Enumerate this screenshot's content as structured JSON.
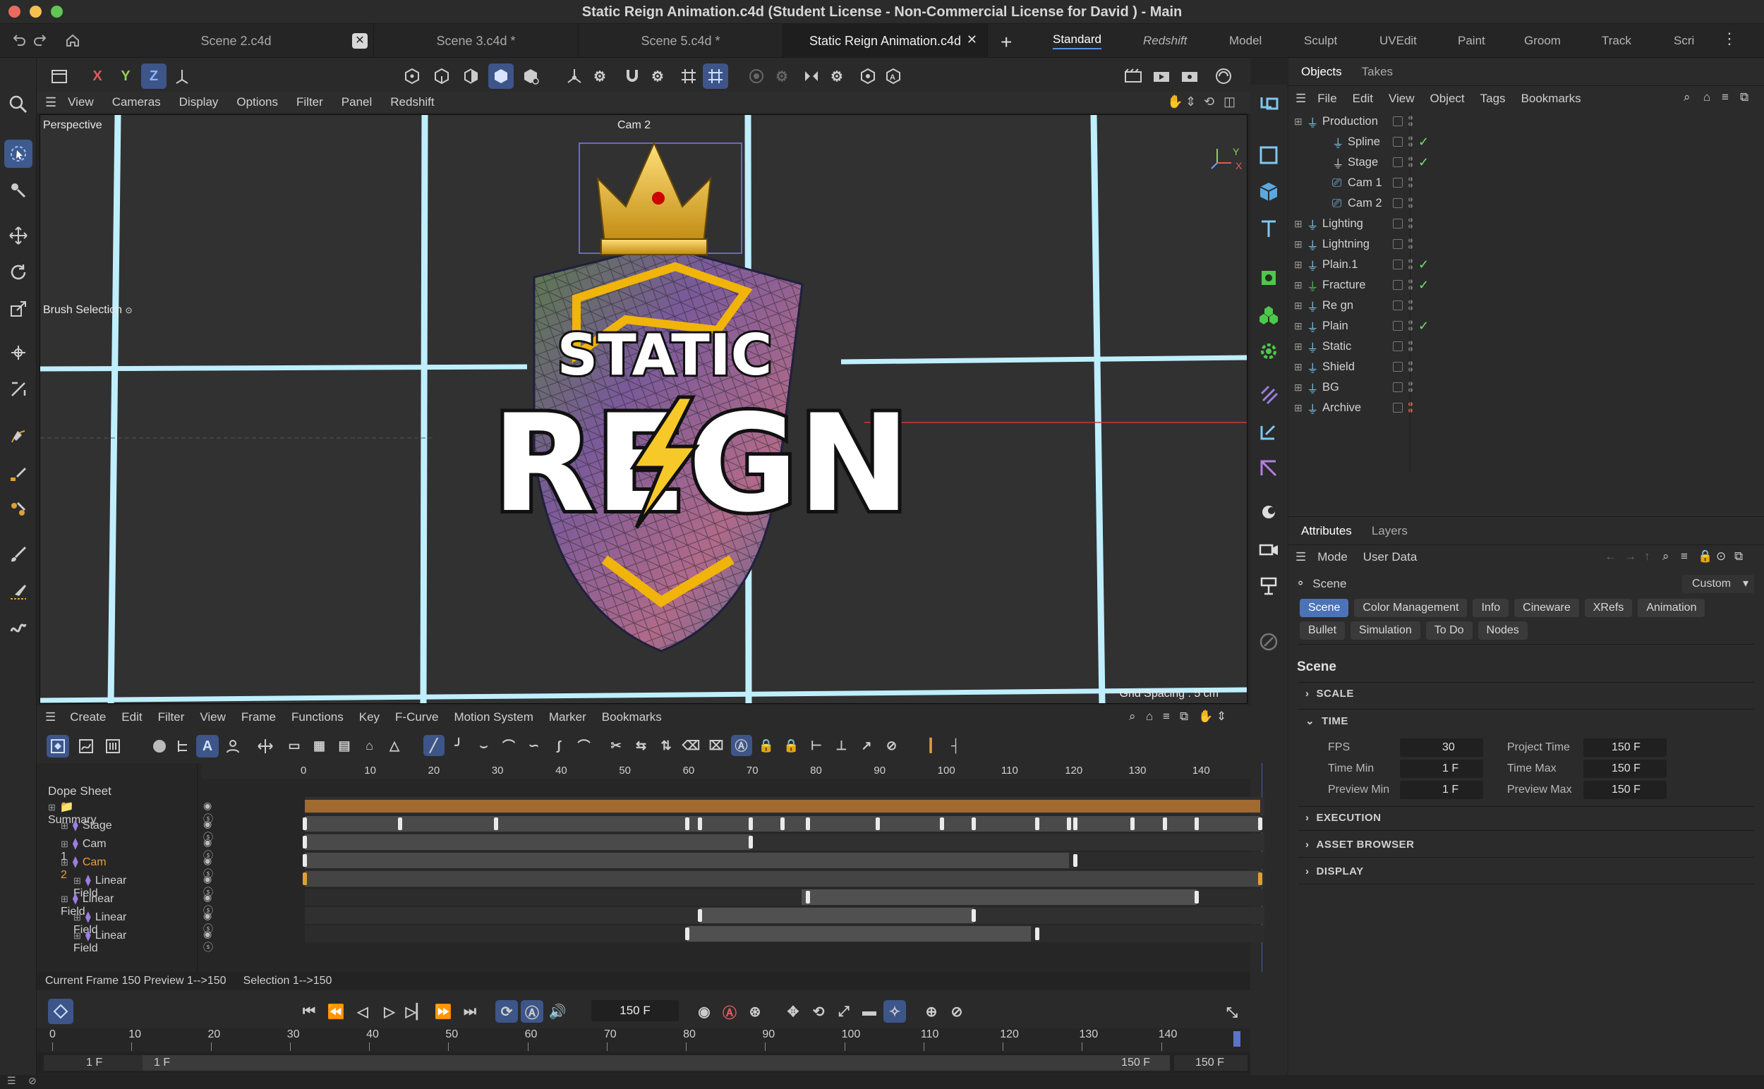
{
  "window": {
    "title": "Static Reign Animation.c4d (Student License - Non-Commercial License for David ) - Main"
  },
  "tabs": [
    {
      "label": "Scene 2.c4d"
    },
    {
      "label": "Scene 3.c4d *"
    },
    {
      "label": "Scene 5.c4d *"
    },
    {
      "label": "Static Reign Animation.c4d"
    }
  ],
  "layouts": [
    "Standard",
    "Redshift",
    "Model",
    "Sculpt",
    "UVEdit",
    "Paint",
    "Groom",
    "Track",
    "Scri"
  ],
  "toolbar": {
    "x": "X",
    "y": "Y",
    "z": "Z"
  },
  "viewport": {
    "menu": [
      "View",
      "Cameras",
      "Display",
      "Options",
      "Filter",
      "Panel",
      "Redshift"
    ],
    "label": "Perspective",
    "camera_label": "Cam 2",
    "brush_label": "Brush Selection",
    "grid_spacing": "Grid Spacing : 5 cm",
    "logo_top": "STATIC",
    "logo_bottom_left": "RE",
    "logo_bottom_right": "GN"
  },
  "objects": {
    "tabs": [
      "Objects",
      "Takes"
    ],
    "menu": [
      "File",
      "Edit",
      "View",
      "Object",
      "Tags",
      "Bookmarks"
    ],
    "items": [
      {
        "name": "Production",
        "indent": 0,
        "check": false
      },
      {
        "name": "Spline",
        "indent": 1,
        "check": true
      },
      {
        "name": "Stage",
        "indent": 1,
        "check": true
      },
      {
        "name": "Cam 1",
        "indent": 1,
        "check": false
      },
      {
        "name": "Cam 2",
        "indent": 1,
        "check": false
      },
      {
        "name": "Lighting",
        "indent": 0,
        "check": false
      },
      {
        "name": "Lightning",
        "indent": 0,
        "check": false
      },
      {
        "name": "Plain.1",
        "indent": 0,
        "check": true
      },
      {
        "name": "Fracture",
        "indent": 0,
        "check": true
      },
      {
        "name": "Re gn",
        "indent": 0,
        "check": false
      },
      {
        "name": "Plain",
        "indent": 0,
        "check": true
      },
      {
        "name": "Static",
        "indent": 0,
        "check": false
      },
      {
        "name": "Shield",
        "indent": 0,
        "check": false
      },
      {
        "name": "BG",
        "indent": 0,
        "check": false
      },
      {
        "name": "Archive",
        "indent": 0,
        "check": false
      }
    ]
  },
  "attributes": {
    "tabs": [
      "Attributes",
      "Layers"
    ],
    "menu": [
      "Mode",
      "User Data"
    ],
    "scene_label": "Scene",
    "preset": "Custom",
    "chips_row1": [
      "Scene",
      "Color Management",
      "Info",
      "Cineware",
      "XRefs",
      "Animation"
    ],
    "chips_row2": [
      "Bullet",
      "Simulation",
      "To Do",
      "Nodes"
    ],
    "heading": "Scene",
    "sections": {
      "scale": "SCALE",
      "time": "TIME",
      "execution": "EXECUTION",
      "asset": "ASSET BROWSER",
      "display": "DISPLAY"
    },
    "fields": {
      "fps_label": "FPS",
      "fps": "30",
      "project_time_label": "Project Time",
      "project_time": "150 F",
      "time_min_label": "Time Min",
      "time_min": "1 F",
      "time_max_label": "Time Max",
      "time_max": "150 F",
      "preview_min_label": "Preview Min",
      "preview_min": "1 F",
      "preview_max_label": "Preview Max",
      "preview_max": "150 F"
    }
  },
  "timeline": {
    "menu": [
      "Create",
      "Edit",
      "Filter",
      "View",
      "Frame",
      "Functions",
      "Key",
      "F-Curve",
      "Motion System",
      "Marker",
      "Bookmarks"
    ],
    "title": "Dope Sheet",
    "ruler": [
      "0",
      "10",
      "20",
      "30",
      "40",
      "50",
      "60",
      "70",
      "80",
      "90",
      "100",
      "110",
      "120",
      "130",
      "140"
    ],
    "tracks": [
      "Summary",
      "Stage",
      "Cam 1",
      "Cam 2",
      "Linear Field",
      "Linear Field",
      "Linear Field",
      "Linear Field"
    ],
    "status": {
      "current": "Current Frame  150  Preview  1-->150",
      "selection": "Selection 1-->150"
    }
  },
  "transport": {
    "frame": "150 F",
    "ruler": [
      "0",
      "10",
      "20",
      "30",
      "40",
      "50",
      "60",
      "70",
      "80",
      "90",
      "100",
      "110",
      "120",
      "130",
      "140"
    ],
    "range_start": "1 F",
    "range_start2": "1 F",
    "range_end": "150 F",
    "range_end2": "150 F"
  }
}
